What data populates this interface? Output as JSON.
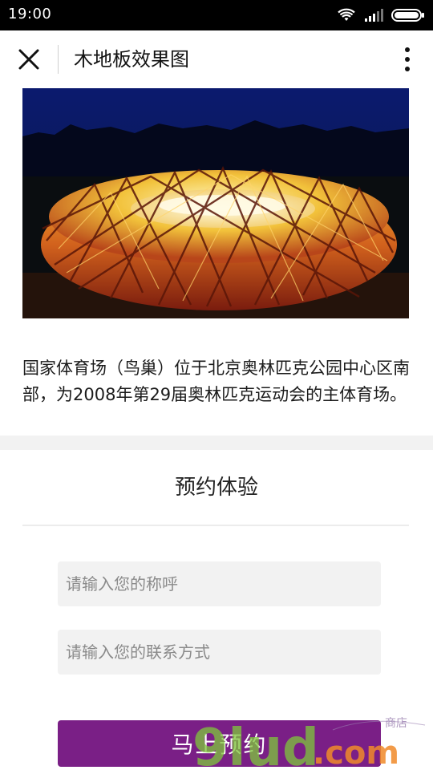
{
  "status_bar": {
    "time": "19:00",
    "icons": [
      "wifi-icon",
      "signal-icon",
      "battery-icon"
    ]
  },
  "header": {
    "title": "木地板效果图",
    "close_icon": "close-icon",
    "more_icon": "more-vertical-icon"
  },
  "hero": {
    "image_subject": "国家体育场（鸟巢）夜景"
  },
  "description": {
    "text": "国家体育场（鸟巢）位于北京奥林匹克公园中心区南部，为2008年第29届奥林匹克运动会的主体育场。"
  },
  "booking": {
    "title": "预约体验",
    "name_placeholder": "请输入您的称呼",
    "phone_placeholder": "请输入您的联系方式",
    "submit_label": "马上预约"
  },
  "watermark": {
    "brand": "9lud",
    "suffix": ".com",
    "caption": "商店"
  },
  "colors": {
    "accent": "#7a1f86",
    "status_bar": "#000000",
    "field_bg": "#f2f2f2",
    "section_gap": "#f2f2f2"
  }
}
